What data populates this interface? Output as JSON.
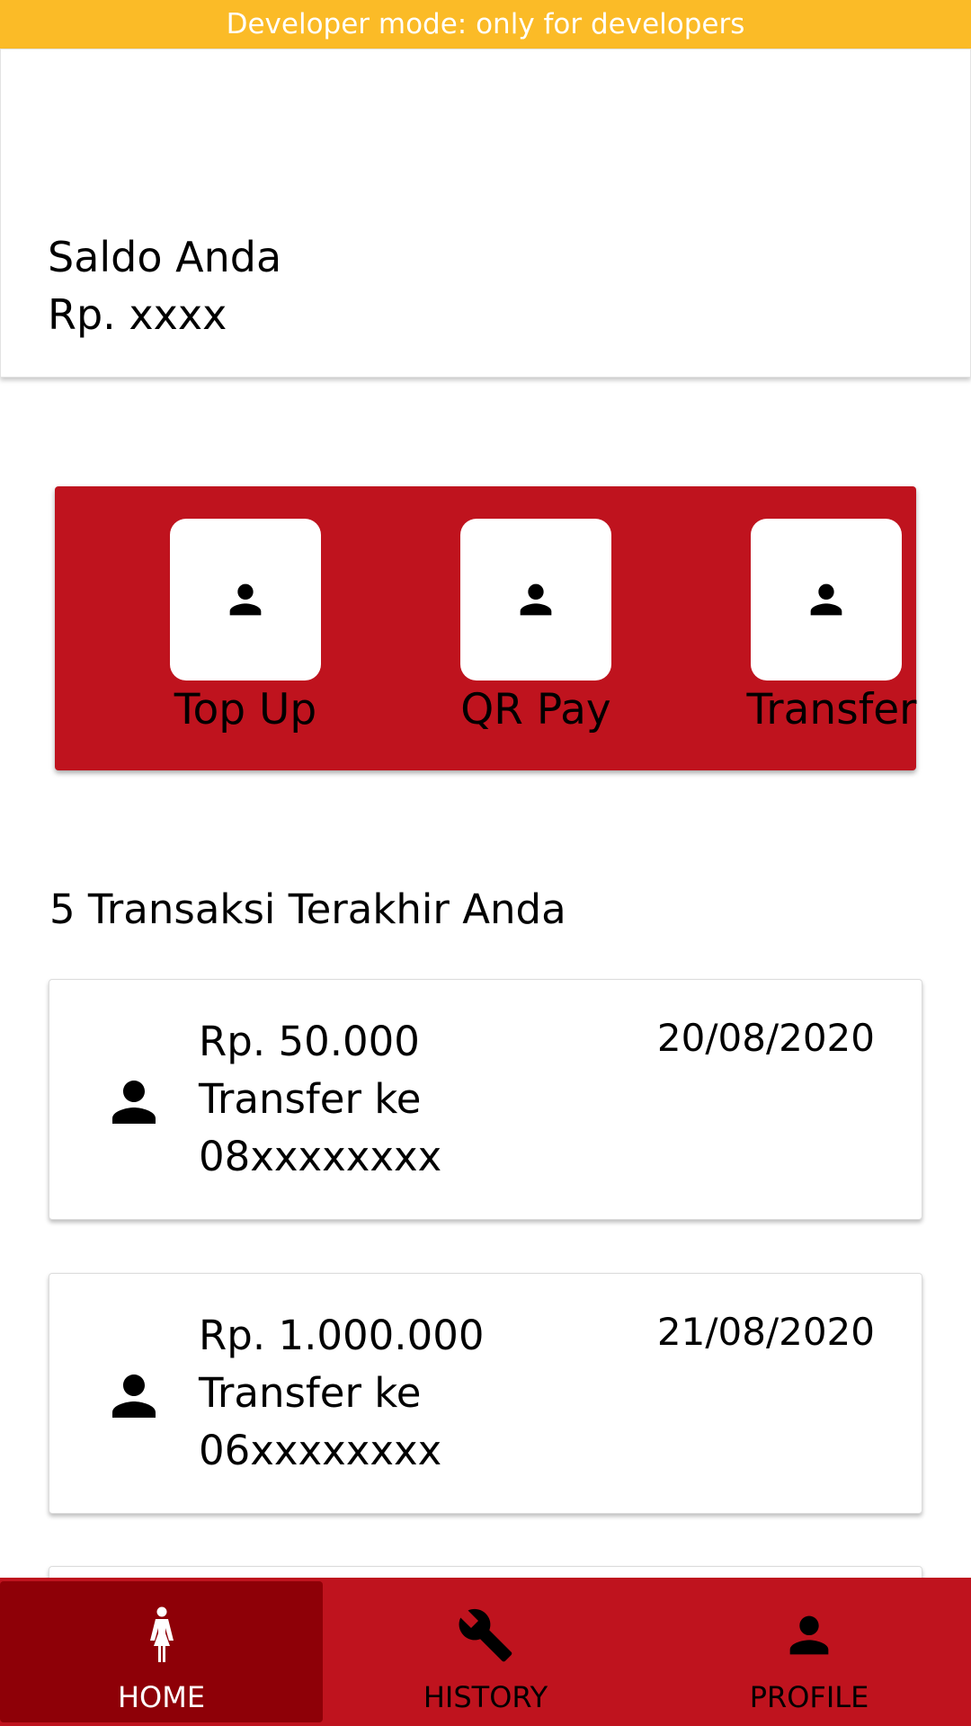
{
  "banner": {
    "text": "Developer mode: only for developers"
  },
  "balance": {
    "label": "Saldo Anda",
    "value": "Rp. xxxx"
  },
  "actions": [
    {
      "label": "Top Up",
      "icon": "person-icon"
    },
    {
      "label": "QR Pay",
      "icon": "person-icon"
    },
    {
      "label": "Transfer",
      "icon": "person-icon"
    }
  ],
  "transactions_title": "5 Transaksi Terakhir Anda",
  "transactions": [
    {
      "amount": "Rp. 50.000",
      "description": "Transfer ke",
      "account": "08xxxxxxxx",
      "date": "20/08/2020"
    },
    {
      "amount": "Rp. 1.000.000",
      "description": "Transfer ke",
      "account": "06xxxxxxxx",
      "date": "21/08/2020"
    }
  ],
  "nav": {
    "items": [
      {
        "label": "HOME",
        "icon": "woman-icon",
        "active": true
      },
      {
        "label": "HISTORY",
        "icon": "wrench-icon",
        "active": false
      },
      {
        "label": "PROFILE",
        "icon": "person-icon",
        "active": false
      }
    ]
  },
  "colors": {
    "banner": "#fbbb27",
    "brand_red": "#bf131e",
    "nav_active": "#8e0007"
  }
}
